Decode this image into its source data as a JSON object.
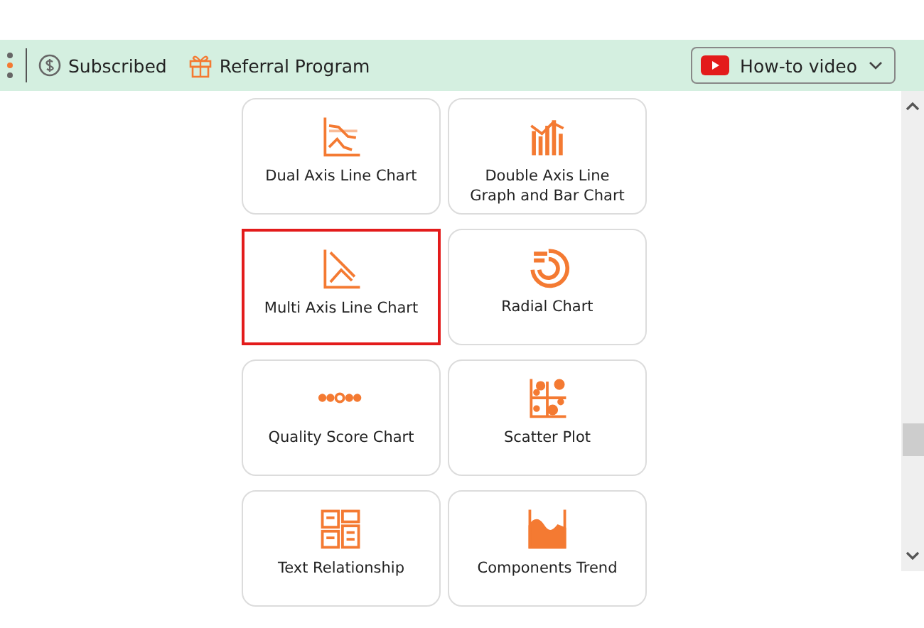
{
  "toolbar": {
    "subscription": "Subscribed",
    "referral": "Referral Program",
    "video_button": "How-to video"
  },
  "charts": [
    {
      "label": "Dual Axis Line Chart",
      "kind": "dual-line",
      "selected": false
    },
    {
      "label": "Double Axis Line Graph and Bar Chart",
      "kind": "line-bar",
      "selected": false
    },
    {
      "label": "Multi Axis Line Chart",
      "kind": "multi-line",
      "selected": true
    },
    {
      "label": "Radial Chart",
      "kind": "radial",
      "selected": false
    },
    {
      "label": "Quality Score Chart",
      "kind": "dots",
      "selected": false
    },
    {
      "label": "Scatter Plot",
      "kind": "scatter",
      "selected": false
    },
    {
      "label": "Text Relationship",
      "kind": "text-boxes",
      "selected": false
    },
    {
      "label": "Components Trend",
      "kind": "trend",
      "selected": false
    }
  ]
}
